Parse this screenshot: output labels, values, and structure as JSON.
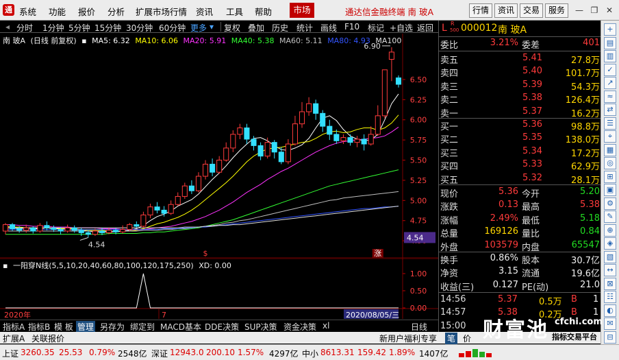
{
  "menubar": {
    "logo": "通",
    "items": [
      "系统",
      "功能",
      "报价",
      "分析",
      "扩展市场行情",
      "资讯",
      "工具",
      "帮助"
    ],
    "market_tab": "市场",
    "title": "通达信金融终端 南 玻A",
    "right_buttons": [
      "行情",
      "资讯",
      "交易",
      "服务"
    ]
  },
  "toolbar": {
    "periods": [
      "分时",
      "1分钟",
      "5分钟",
      "15分钟",
      "30分钟",
      "60分钟"
    ],
    "more": "更多",
    "actions": [
      "复权",
      "叠加",
      "历史",
      "统计",
      "画线",
      "F10",
      "标记",
      "+自选",
      "返回"
    ]
  },
  "legend": {
    "stock": "南 玻A",
    "mode": "(日线 前复权)",
    "items": [
      {
        "label": "MA5: 6.32",
        "color": "#ffffff"
      },
      {
        "label": "MA10: 6.06",
        "color": "#ffff00"
      },
      {
        "label": "MA20: 5.91",
        "color": "#ff33ff"
      },
      {
        "label": "MA40: 5.38",
        "color": "#33ff33"
      },
      {
        "label": "MA60: 5.11",
        "color": "#c0c0c0"
      },
      {
        "label": "MA80: 4.93",
        "color": "#3355ff"
      },
      {
        "label": "MA100",
        "color": "#e0e0e0"
      }
    ]
  },
  "chart_data": {
    "type": "candlestick",
    "ylim": [
      4.45,
      6.95
    ],
    "y_ticks": [
      "6.50",
      "6.25",
      "6.00",
      "5.75",
      "5.50",
      "5.25",
      "5.00",
      "4.75",
      "4.50"
    ],
    "high_label": "6.90",
    "low_label": "4.54",
    "price_tag": "4.54",
    "candles": [
      [
        4.62,
        4.7,
        4.58,
        4.72
      ],
      [
        4.7,
        4.65,
        4.62,
        4.72
      ],
      [
        4.65,
        4.63,
        4.6,
        4.68
      ],
      [
        4.63,
        4.66,
        4.6,
        4.7
      ],
      [
        4.66,
        4.62,
        4.59,
        4.68
      ],
      [
        4.62,
        4.69,
        4.6,
        4.72
      ],
      [
        4.69,
        4.66,
        4.63,
        4.74
      ],
      [
        4.66,
        4.64,
        4.61,
        4.69
      ],
      [
        4.64,
        4.62,
        4.58,
        4.67
      ],
      [
        4.62,
        4.66,
        4.6,
        4.7
      ],
      [
        4.66,
        4.63,
        4.6,
        4.69
      ],
      [
        4.63,
        4.6,
        4.56,
        4.66
      ],
      [
        4.6,
        4.58,
        4.54,
        4.63
      ],
      [
        4.58,
        4.62,
        4.56,
        4.65
      ],
      [
        4.62,
        4.6,
        4.57,
        4.66
      ],
      [
        4.6,
        4.63,
        4.58,
        4.66
      ],
      [
        4.63,
        4.61,
        4.58,
        4.66
      ],
      [
        4.61,
        4.64,
        4.59,
        4.69
      ],
      [
        4.64,
        4.7,
        4.62,
        4.72
      ],
      [
        4.7,
        4.68,
        4.66,
        4.74
      ],
      [
        4.68,
        4.82,
        4.66,
        4.86
      ],
      [
        4.82,
        4.92,
        4.78,
        4.96
      ],
      [
        4.92,
        4.88,
        4.84,
        4.98
      ],
      [
        4.88,
        4.84,
        4.8,
        4.93
      ],
      [
        4.84,
        4.95,
        4.82,
        5.0
      ],
      [
        4.95,
        5.05,
        4.93,
        5.1
      ],
      [
        5.05,
        5.18,
        5.02,
        5.22
      ],
      [
        5.18,
        5.12,
        5.08,
        5.25
      ],
      [
        5.12,
        5.3,
        5.1,
        5.35
      ],
      [
        5.3,
        5.45,
        5.26,
        5.5
      ],
      [
        5.45,
        5.35,
        5.3,
        5.52
      ],
      [
        5.35,
        5.5,
        5.33,
        5.55
      ],
      [
        5.5,
        5.65,
        5.48,
        5.72
      ],
      [
        5.65,
        5.82,
        5.6,
        5.87
      ],
      [
        5.82,
        5.9,
        5.76,
        5.95
      ],
      [
        5.9,
        5.76,
        5.7,
        5.95
      ],
      [
        5.76,
        5.68,
        5.62,
        5.8
      ],
      [
        5.68,
        5.55,
        5.5,
        5.72
      ],
      [
        5.55,
        5.72,
        5.52,
        5.78
      ],
      [
        5.72,
        5.6,
        5.52,
        5.75
      ],
      [
        5.6,
        5.48,
        5.45,
        5.66
      ],
      [
        5.48,
        5.7,
        5.45,
        5.76
      ],
      [
        5.7,
        5.95,
        5.68,
        6.05
      ],
      [
        5.95,
        6.1,
        5.9,
        6.22
      ],
      [
        6.1,
        6.2,
        6.05,
        6.28
      ],
      [
        6.2,
        6.08,
        6.0,
        6.25
      ],
      [
        6.08,
        5.92,
        5.85,
        6.12
      ],
      [
        5.92,
        5.82,
        5.75,
        6.0
      ],
      [
        5.82,
        5.74,
        5.7,
        5.88
      ],
      [
        5.74,
        5.78,
        5.7,
        5.82
      ],
      [
        5.78,
        5.72,
        5.68,
        5.82
      ],
      [
        5.72,
        5.76,
        5.66,
        5.8
      ],
      [
        5.76,
        5.7,
        5.62,
        5.82
      ],
      [
        5.7,
        5.82,
        5.68,
        5.92
      ],
      [
        5.82,
        6.05,
        5.8,
        6.18
      ],
      [
        6.05,
        6.62,
        6.02,
        6.62
      ],
      [
        6.75,
        6.84,
        6.48,
        6.9
      ],
      [
        6.52,
        6.44,
        6.4,
        6.55
      ]
    ],
    "ma": [
      {
        "name": "MA5",
        "color": "#ffffff",
        "values": [
          4.66,
          4.66,
          4.65,
          4.66,
          4.65,
          4.65,
          4.66,
          4.65,
          4.65,
          4.64,
          4.64,
          4.63,
          4.62,
          4.61,
          4.61,
          4.61,
          4.61,
          4.62,
          4.63,
          4.65,
          4.69,
          4.75,
          4.8,
          4.83,
          4.87,
          4.93,
          4.97,
          5.01,
          5.08,
          5.17,
          5.26,
          5.34,
          5.43,
          5.53,
          5.62,
          5.7,
          5.77,
          5.78,
          5.74,
          5.68,
          5.63,
          5.62,
          5.65,
          5.69,
          5.77,
          5.9,
          6.02,
          6.05,
          5.99,
          5.88,
          5.8,
          5.76,
          5.74,
          5.75,
          5.82,
          6.0,
          6.2,
          6.32
        ]
      },
      {
        "name": "MA10",
        "color": "#ffff00",
        "values": [
          4.68,
          4.67,
          4.67,
          4.66,
          4.66,
          4.66,
          4.66,
          4.66,
          4.65,
          4.65,
          4.65,
          4.64,
          4.63,
          4.63,
          4.63,
          4.62,
          4.62,
          4.62,
          4.62,
          4.63,
          4.65,
          4.68,
          4.71,
          4.73,
          4.76,
          4.79,
          4.83,
          4.88,
          4.94,
          5.01,
          5.08,
          5.15,
          5.22,
          5.3,
          5.39,
          5.48,
          5.55,
          5.6,
          5.64,
          5.65,
          5.66,
          5.68,
          5.7,
          5.72,
          5.73,
          5.77,
          5.82,
          5.85,
          5.86,
          5.84,
          5.85,
          5.88,
          5.9,
          5.9,
          5.87,
          5.9,
          5.96,
          6.06
        ]
      },
      {
        "name": "MA20",
        "color": "#ff33ff",
        "values": [
          4.7,
          4.7,
          4.69,
          4.69,
          4.68,
          4.68,
          4.68,
          4.67,
          4.67,
          4.67,
          4.66,
          4.66,
          4.66,
          4.66,
          4.65,
          4.65,
          4.65,
          4.64,
          4.64,
          4.64,
          4.64,
          4.65,
          4.66,
          4.67,
          4.68,
          4.7,
          4.72,
          4.74,
          4.77,
          4.8,
          4.84,
          4.88,
          4.93,
          4.98,
          5.04,
          5.1,
          5.15,
          5.2,
          5.26,
          5.31,
          5.36,
          5.4,
          5.45,
          5.5,
          5.55,
          5.6,
          5.64,
          5.68,
          5.71,
          5.73,
          5.74,
          5.75,
          5.76,
          5.77,
          5.78,
          5.8,
          5.85,
          5.91
        ]
      },
      {
        "name": "MA40",
        "color": "#33ff33",
        "values": [
          4.58,
          4.58,
          4.58,
          4.58,
          4.58,
          4.58,
          4.58,
          4.58,
          4.58,
          4.58,
          4.58,
          4.58,
          4.58,
          4.58,
          4.58,
          4.59,
          4.59,
          4.59,
          4.59,
          4.59,
          4.6,
          4.6,
          4.61,
          4.61,
          4.62,
          4.63,
          4.64,
          4.65,
          4.66,
          4.68,
          4.7,
          4.72,
          4.74,
          4.76,
          4.79,
          4.82,
          4.85,
          4.88,
          4.91,
          4.94,
          4.97,
          5.0,
          5.03,
          5.06,
          5.09,
          5.12,
          5.15,
          5.18,
          5.2,
          5.22,
          5.24,
          5.26,
          5.28,
          5.3,
          5.32,
          5.34,
          5.36,
          5.38
        ]
      },
      {
        "name": "MA60",
        "color": "#c0c0c0",
        "values": [
          4.62,
          4.62,
          4.62,
          4.62,
          4.62,
          4.62,
          4.62,
          4.62,
          4.62,
          4.62,
          4.62,
          4.62,
          4.62,
          4.62,
          4.62,
          4.62,
          4.62,
          4.62,
          4.62,
          4.62,
          4.63,
          4.63,
          4.63,
          4.64,
          4.64,
          4.65,
          4.65,
          4.66,
          4.67,
          4.68,
          4.69,
          4.7,
          4.72,
          4.73,
          4.75,
          4.76,
          4.78,
          4.8,
          4.82,
          4.84,
          4.86,
          4.88,
          4.9,
          4.92,
          4.94,
          4.96,
          4.98,
          5.0,
          5.01,
          5.03,
          5.04,
          5.05,
          5.06,
          5.07,
          5.08,
          5.09,
          5.1,
          5.11
        ]
      },
      {
        "name": "MA80",
        "color": "#3355ff",
        "values": [
          4.64,
          4.64,
          4.64,
          4.64,
          4.64,
          4.64,
          4.64,
          4.64,
          4.64,
          4.64,
          4.64,
          4.64,
          4.64,
          4.64,
          4.64,
          4.64,
          4.64,
          4.64,
          4.64,
          4.64,
          4.64,
          4.64,
          4.64,
          4.65,
          4.65,
          4.65,
          4.66,
          4.66,
          4.67,
          4.67,
          4.68,
          4.69,
          4.7,
          4.71,
          4.72,
          4.73,
          4.74,
          4.75,
          4.76,
          4.77,
          4.78,
          4.79,
          4.8,
          4.81,
          4.82,
          4.83,
          4.84,
          4.85,
          4.86,
          4.87,
          4.88,
          4.89,
          4.9,
          4.9,
          4.91,
          4.92,
          4.92,
          4.93
        ]
      },
      {
        "name": "MA100",
        "color": "#e0e0e0",
        "values": [
          4.66,
          4.66,
          4.66,
          4.66,
          4.66,
          4.66,
          4.66,
          4.66,
          4.66,
          4.66,
          4.66,
          4.66,
          4.66,
          4.66,
          4.66,
          4.66,
          4.66,
          4.66,
          4.66,
          4.66,
          4.66,
          4.66,
          4.66,
          4.66,
          4.66,
          4.66,
          4.67,
          4.67,
          4.67,
          4.68,
          4.68,
          4.69,
          4.69,
          4.7,
          4.7,
          4.71,
          4.72,
          4.73,
          4.74,
          4.75,
          4.76,
          4.77,
          4.78,
          4.79,
          4.8,
          4.81,
          4.82,
          4.83,
          4.84,
          4.85,
          4.86,
          4.87,
          4.88,
          4.89,
          4.9,
          4.91,
          4.92,
          4.93
        ]
      }
    ],
    "markers": [
      {
        "index": 29,
        "text": "$"
      },
      {
        "index": 54,
        "text": "涨"
      }
    ]
  },
  "sub_chart": {
    "title": "一阳穿N线(5,5,10,20,40,60,80,100,120,175,250)",
    "value_label": "XD: 0.00",
    "y_ticks": [
      "1.00",
      "0.50",
      "0.00"
    ],
    "signal_index": 20,
    "x_labels": {
      "left": "2020年",
      "mid": "7",
      "right": "2020/08/05/三"
    }
  },
  "tabs1": {
    "items": [
      "指标A",
      "指标B",
      "模 板",
      "管理",
      "另存为",
      "绑定到",
      "MACD基本",
      "DDE决策",
      "SUP决策",
      "资金决策",
      "xl"
    ],
    "active": "管理",
    "period_label": "日线"
  },
  "tabs2": {
    "items": [
      "扩展A",
      "关联报价"
    ],
    "promo": "新用户福利专享",
    "mini": [
      "笔",
      "价"
    ]
  },
  "statusbar": {
    "sh_label": "上证",
    "sh_val": "3260.35",
    "sh_chg": "25.53",
    "sh_pct": "0.79%",
    "sh_amt": "2548亿",
    "sz_label": "深证",
    "sz_val": "12943.0",
    "sz_chg": "200.10",
    "sz_pct": "1.57%",
    "sz_amt": "4297亿",
    "zx_label": "中小",
    "zx_val": "8613.31",
    "zx_chg": "159.42",
    "zx_pct": "1.89%",
    "zx_amt": "1407亿"
  },
  "quote": {
    "code_prefix": "L",
    "code_mark": "R",
    "code_sub": "500",
    "code": "000012",
    "name": "南 玻A",
    "webi": {
      "label": "委比",
      "value": "3.21%",
      "label2": "委差",
      "value2": "401"
    },
    "asks": [
      {
        "label": "卖五",
        "price": "5.41",
        "vol": "27.8万"
      },
      {
        "label": "卖四",
        "price": "5.40",
        "vol": "101.7万"
      },
      {
        "label": "卖三",
        "price": "5.39",
        "vol": "54.3万"
      },
      {
        "label": "卖二",
        "price": "5.38",
        "vol": "126.4万"
      },
      {
        "label": "卖一",
        "price": "5.37",
        "vol": "16.2万"
      }
    ],
    "bids": [
      {
        "label": "买一",
        "price": "5.36",
        "vol": "98.8万"
      },
      {
        "label": "买二",
        "price": "5.35",
        "vol": "138.0万"
      },
      {
        "label": "买三",
        "price": "5.34",
        "vol": "17.2万"
      },
      {
        "label": "买四",
        "price": "5.33",
        "vol": "62.9万"
      },
      {
        "label": "买五",
        "price": "5.32",
        "vol": "28.1万"
      }
    ],
    "stats": [
      {
        "l1": "现价",
        "v1": "5.36",
        "c1": "red",
        "l2": "今开",
        "v2": "5.20",
        "c2": "green"
      },
      {
        "l1": "涨跌",
        "v1": "0.13",
        "c1": "red",
        "l2": "最高",
        "v2": "5.38",
        "c2": "red"
      },
      {
        "l1": "涨幅",
        "v1": "2.49%",
        "c1": "red",
        "l2": "最低",
        "v2": "5.18",
        "c2": "green"
      },
      {
        "l1": "总量",
        "v1": "169126",
        "c1": "yellow",
        "l2": "量比",
        "v2": "0.84",
        "c2": "green"
      },
      {
        "l1": "外盘",
        "v1": "103579",
        "c1": "red",
        "l2": "内盘",
        "v2": "65547",
        "c2": "green"
      }
    ],
    "stats2": [
      {
        "l1": "换手",
        "v1": "0.86%",
        "c1": "white",
        "l2": "股本",
        "v2": "30.7亿",
        "c2": "white"
      },
      {
        "l1": "净资",
        "v1": "3.15",
        "c1": "white",
        "l2": "流通",
        "v2": "19.6亿",
        "c2": "white"
      },
      {
        "l1": "收益(三)",
        "v1": "0.127",
        "c1": "white",
        "l2": "PE(动)",
        "v2": "21.0",
        "c2": "white"
      }
    ],
    "ticks": [
      {
        "time": "14:56",
        "price": "5.37",
        "vol": "0.5万",
        "bs": "B",
        "n": "1"
      },
      {
        "time": "14:57",
        "price": "5.38",
        "vol": "0.2万",
        "bs": "B",
        "n": "1"
      },
      {
        "time": "15:00",
        "price": "",
        "vol": "",
        "bs": "",
        "n": ""
      }
    ]
  },
  "vtools": [
    "+",
    "▤",
    "▥",
    "✓",
    "↗",
    "≈",
    "⇄",
    "☰",
    "⌖",
    "▦",
    "◎",
    "⊞",
    "▣",
    "⚙",
    "✎",
    "⊕",
    "◈",
    "▧",
    "↔",
    "⊠",
    "☷",
    "◐",
    "✉",
    "⊟"
  ],
  "watermark": {
    "big": "财富池",
    "url": "cfchi.com",
    "sub": "指标交易平台"
  }
}
